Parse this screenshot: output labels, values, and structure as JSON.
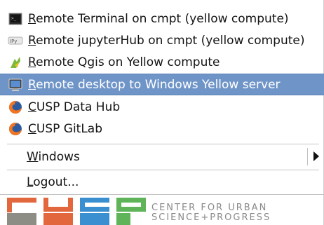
{
  "menu": {
    "items": [
      {
        "label": "Remote Terminal on cmpt (yellow compute)",
        "icon": "terminal-icon"
      },
      {
        "label": "Remote jupyterHub on cmpt (yellow compute)",
        "icon": "jupyter-icon"
      },
      {
        "label": "Remote Qgis on Yellow compute",
        "icon": "qgis-icon"
      },
      {
        "label": "Remote desktop to Windows Yellow server",
        "icon": "monitor-icon"
      },
      {
        "label": "CUSP Data Hub",
        "icon": "firefox-icon"
      },
      {
        "label": "CUSP GitLab",
        "icon": "firefox-icon"
      }
    ],
    "windows": "Windows",
    "logout": "Logout..."
  },
  "footer": {
    "logo": "CUSP",
    "line1": "CENTER FOR URBAN",
    "line2": "SCIENCE+PROGRESS"
  },
  "colors": {
    "selection": "#6f95c8",
    "logo_orange": "#e2673d",
    "logo_blue": "#3a8fd0",
    "logo_green": "#5fb45a",
    "logo_gray": "#8d8d86"
  }
}
